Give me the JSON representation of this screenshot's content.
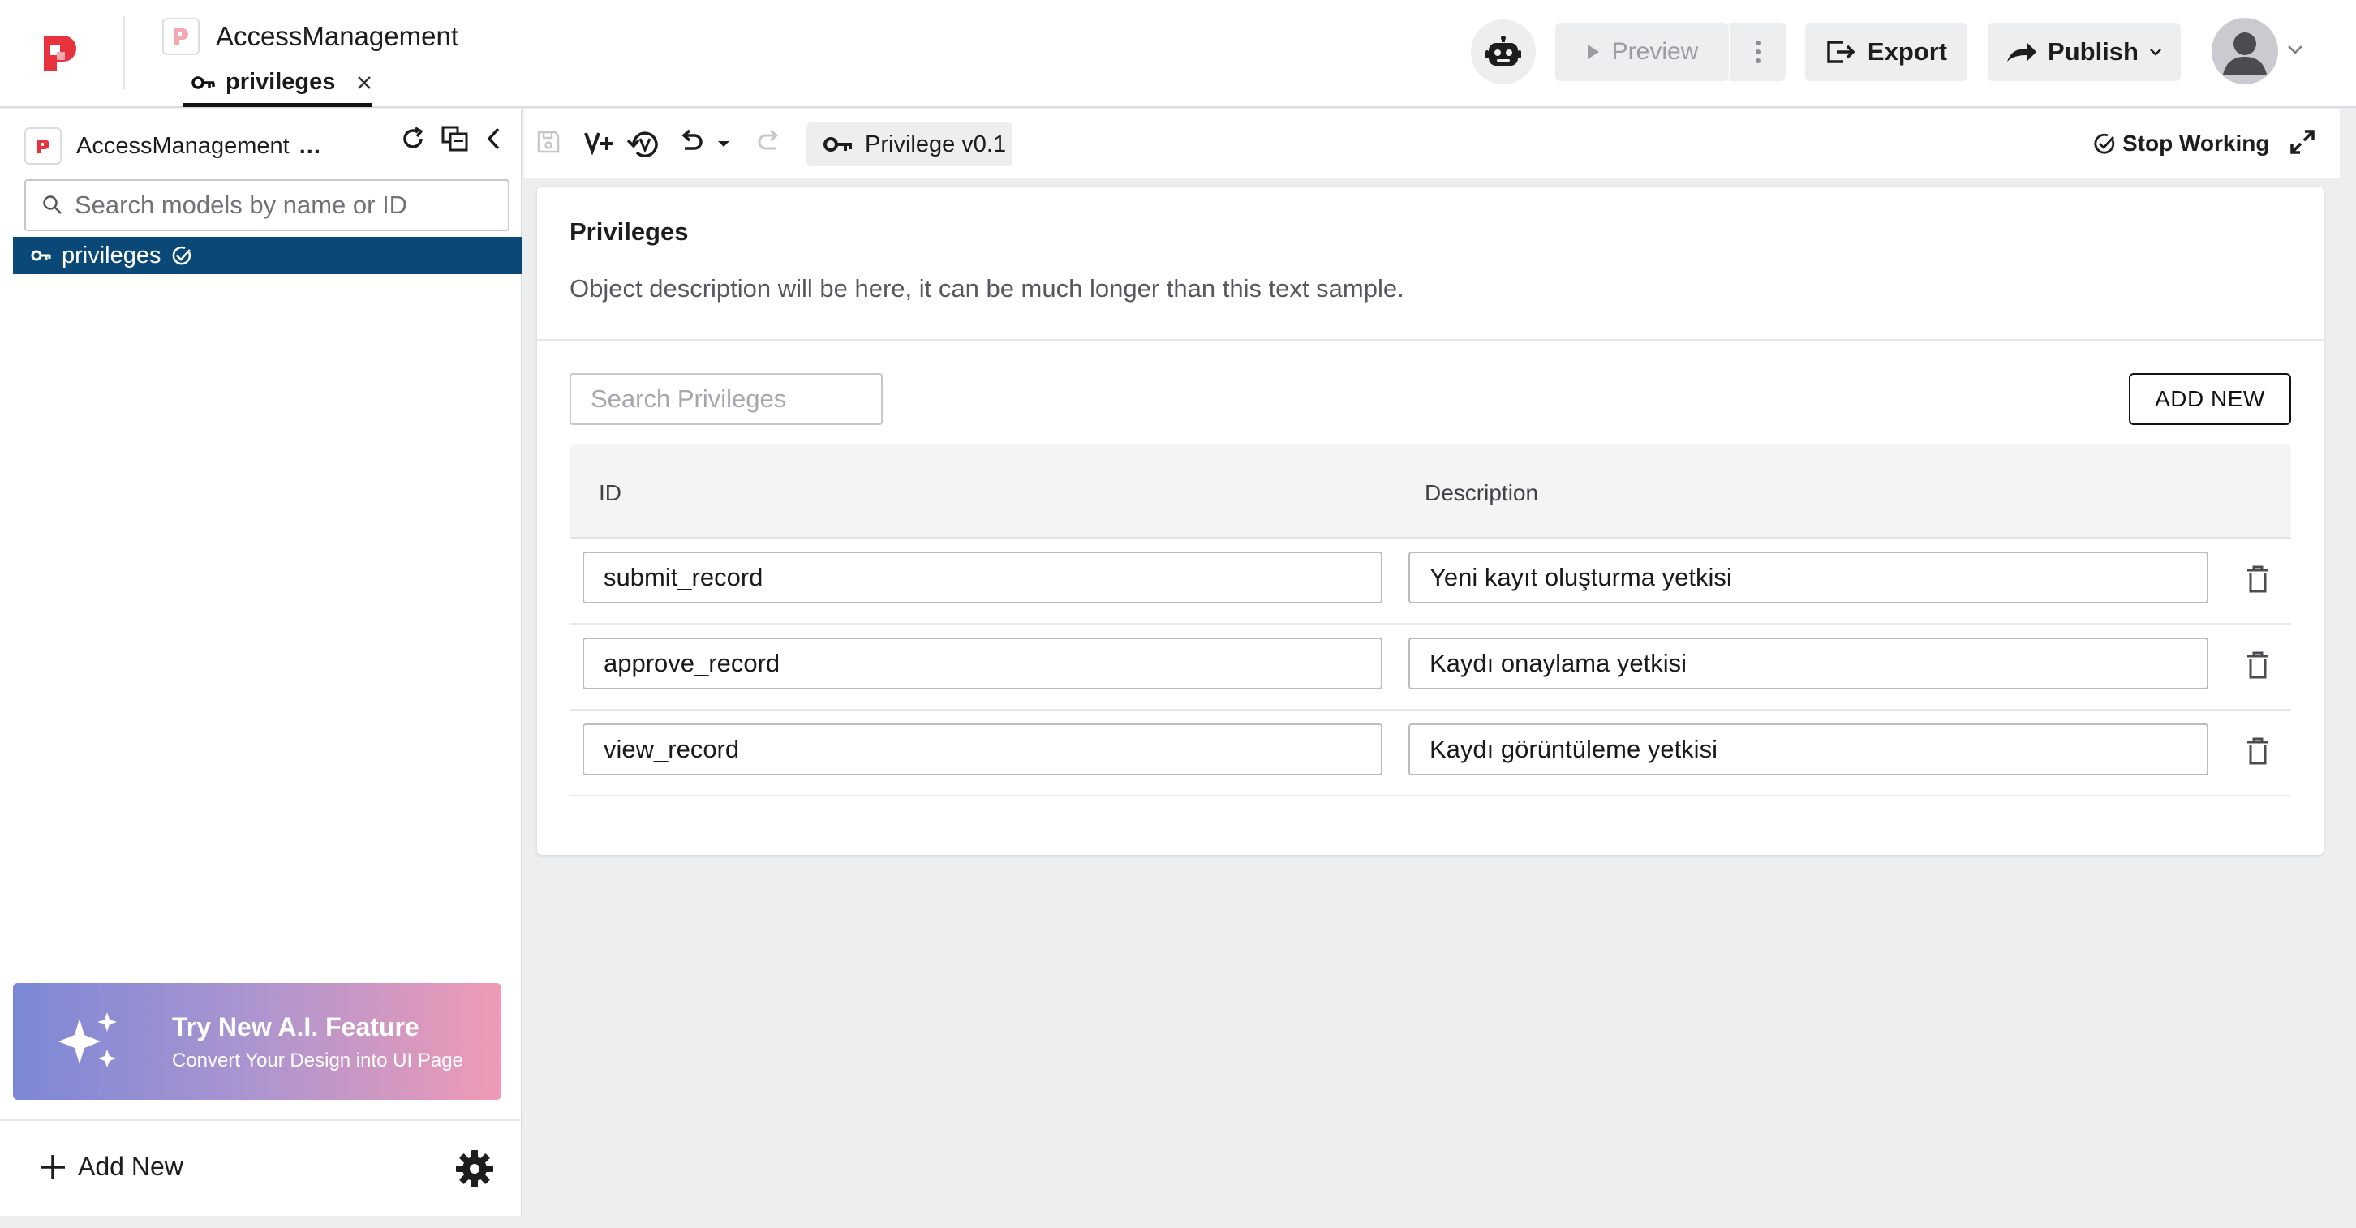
{
  "header": {
    "project_name": "AccessManagement",
    "active_tab": "privileges",
    "preview_label": "Preview",
    "export_label": "Export",
    "publish_label": "Publish"
  },
  "sidebar": {
    "project_name": "AccessManagement",
    "more_label": "...",
    "search_placeholder": "Search models by name or ID",
    "items": [
      {
        "label": "privileges"
      }
    ],
    "ai_banner": {
      "title": "Try New A.I. Feature",
      "subtitle": "Convert Your Design into UI Page"
    },
    "add_new_label": "Add New"
  },
  "toolbar": {
    "version_label": "Privilege v0.1",
    "stop_working_label": "Stop Working"
  },
  "main": {
    "title": "Privileges",
    "description": "Object description will be here, it can be much longer than this text sample.",
    "search_placeholder": "Search Privileges",
    "add_button_label": "ADD NEW",
    "columns": [
      "ID",
      "Description"
    ],
    "rows": [
      {
        "id": "submit_record",
        "description": "Yeni kayıt oluşturma yetkisi"
      },
      {
        "id": "approve_record",
        "description": "Kaydı onaylama yetkisi"
      },
      {
        "id": "view_record",
        "description": "Kaydı görüntüleme yetkisi"
      }
    ]
  },
  "colors": {
    "selected_item_bg": "#0a4877",
    "brand_red": "#e8333f",
    "banner_gradient_start": "#7b87d6",
    "banner_gradient_end": "#f09ab5"
  },
  "icons": {
    "logo": "brand-logo-icon",
    "key": "key-icon",
    "close": "close-icon",
    "bot": "robot-icon",
    "play": "play-icon",
    "more": "more-vertical-icon",
    "export": "export-icon",
    "publish": "share-arrow-icon",
    "avatar": "user-avatar-icon",
    "refresh": "refresh-icon",
    "copy": "copy-icon",
    "collapse": "chevron-left-icon",
    "search": "search-icon",
    "check_circle": "check-circle-icon",
    "sparkle": "sparkle-icon",
    "plus": "plus-icon",
    "gear": "gear-icon",
    "save": "save-icon",
    "version_add": "version-add-icon",
    "history": "history-icon",
    "undo": "undo-icon",
    "redo": "redo-icon",
    "expand": "expand-icon",
    "trash": "trash-icon"
  }
}
